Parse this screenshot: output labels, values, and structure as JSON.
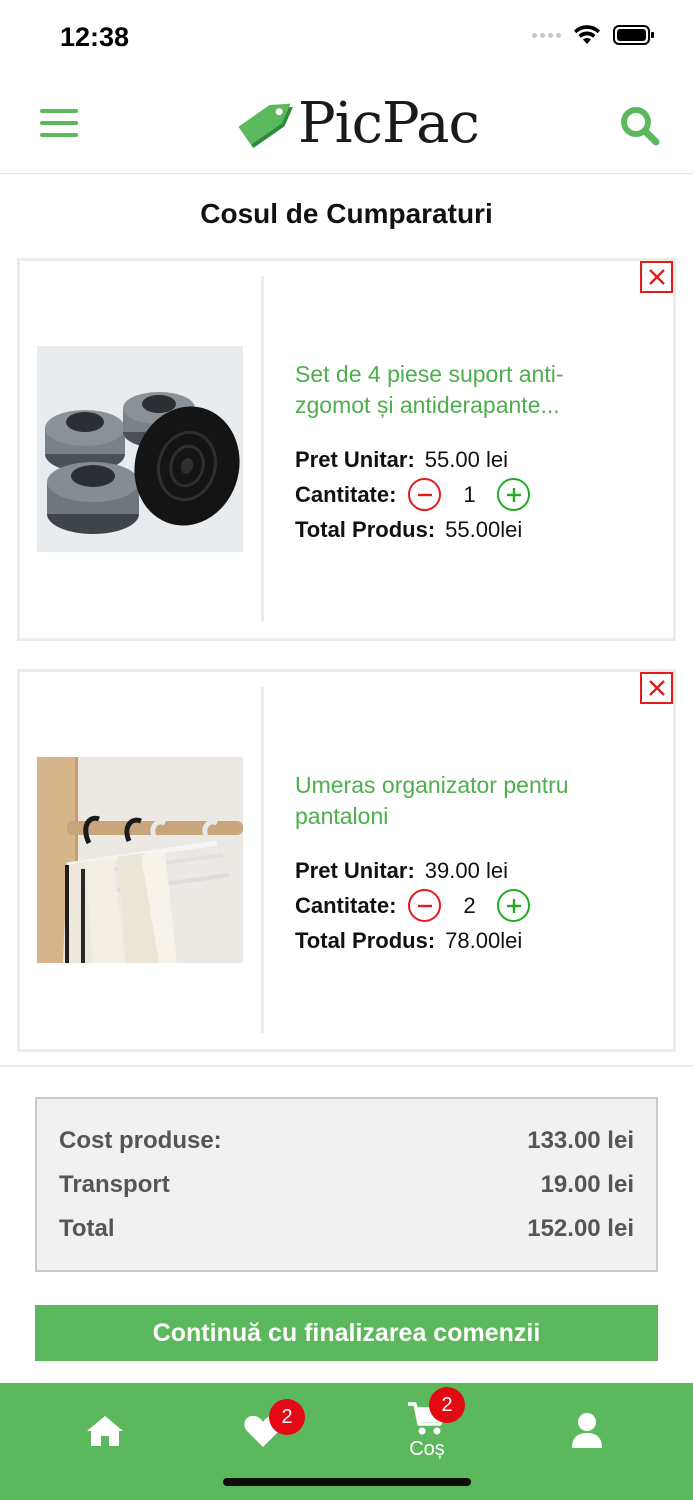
{
  "status_bar": {
    "time": "12:38"
  },
  "header": {
    "logo_text": "PicPac"
  },
  "page_title": "Cosul de Cumparaturi",
  "cart_items": [
    {
      "name_line1": "Set de 4 piese suport anti-",
      "name_line2": "zgomot și antiderapante...",
      "unit_price_label": "Pret Unitar:",
      "unit_price": "55.00 lei",
      "quantity_label": "Cantitate:",
      "quantity": "1",
      "total_label": "Total Produs:",
      "total": "55.00lei"
    },
    {
      "name_line1": "Umeras organizator pentru",
      "name_line2": "pantaloni",
      "unit_price_label": "Pret Unitar:",
      "unit_price": "39.00 lei",
      "quantity_label": "Cantitate:",
      "quantity": "2",
      "total_label": "Total Produs:",
      "total": "78.00lei"
    }
  ],
  "summary": {
    "products_label": "Cost produse:",
    "products_value": "133.00 lei",
    "transport_label": "Transport",
    "transport_value": "19.00 lei",
    "total_label": "Total",
    "total_value": "152.00 lei"
  },
  "checkout_label": "Continuă cu finalizarea comenzii",
  "tab_bar": {
    "favorites_badge": "2",
    "cart_badge": "2",
    "cart_label": "Coș"
  },
  "colors": {
    "brand_green": "#5cb85c",
    "link_green": "#4cae4c",
    "remove_red": "#e21b1b",
    "badge_red": "#e50914"
  },
  "icons": [
    "menu-icon",
    "search-icon",
    "close-icon",
    "minus-icon",
    "plus-icon",
    "home-icon",
    "heart-icon",
    "cart-icon",
    "user-icon",
    "wifi-icon",
    "battery-icon"
  ]
}
